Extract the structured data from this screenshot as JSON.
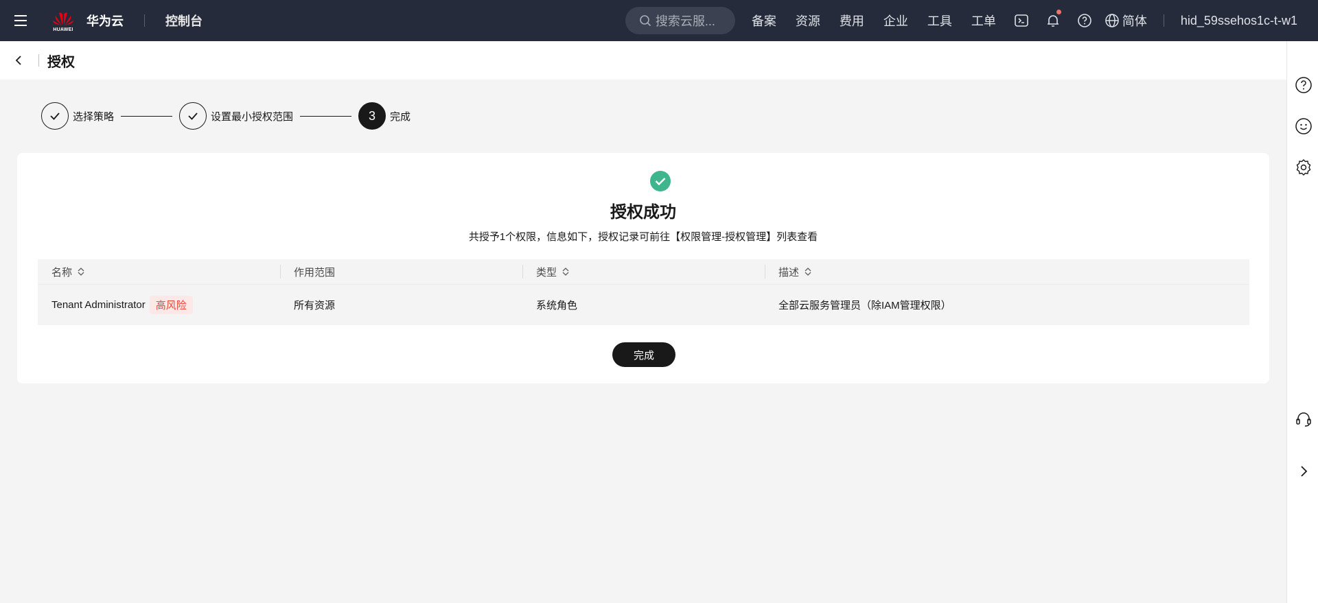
{
  "topbar": {
    "logo_text": "HUAWEI",
    "brand": "华为云",
    "console": "控制台",
    "search_placeholder": "搜索云服...",
    "nav": [
      "备案",
      "资源",
      "费用",
      "企业",
      "工具",
      "工单"
    ],
    "language": "简体",
    "user": "hid_59ssehos1c-t-w1"
  },
  "subheader": {
    "title": "授权"
  },
  "steps": [
    {
      "label": "选择策略",
      "state": "done"
    },
    {
      "label": "设置最小授权范围",
      "state": "done"
    },
    {
      "number": "3",
      "label": "完成",
      "state": "active"
    }
  ],
  "result": {
    "title": "授权成功",
    "description": "共授予1个权限，信息如下，授权记录可前往【权限管理-授权管理】列表查看"
  },
  "table": {
    "headers": [
      "名称",
      "作用范围",
      "类型",
      "描述"
    ],
    "rows": [
      {
        "name": "Tenant Administrator",
        "risk_tag": "高风险",
        "scope": "所有资源",
        "type": "系统角色",
        "description": "全部云服务管理员（除IAM管理权限）"
      }
    ]
  },
  "done_button": "完成",
  "colors": {
    "topbar": "#252b3a",
    "success": "#3fb58d",
    "danger_tag_bg": "#fde8e8",
    "danger_tag_text": "#e84a3a"
  }
}
